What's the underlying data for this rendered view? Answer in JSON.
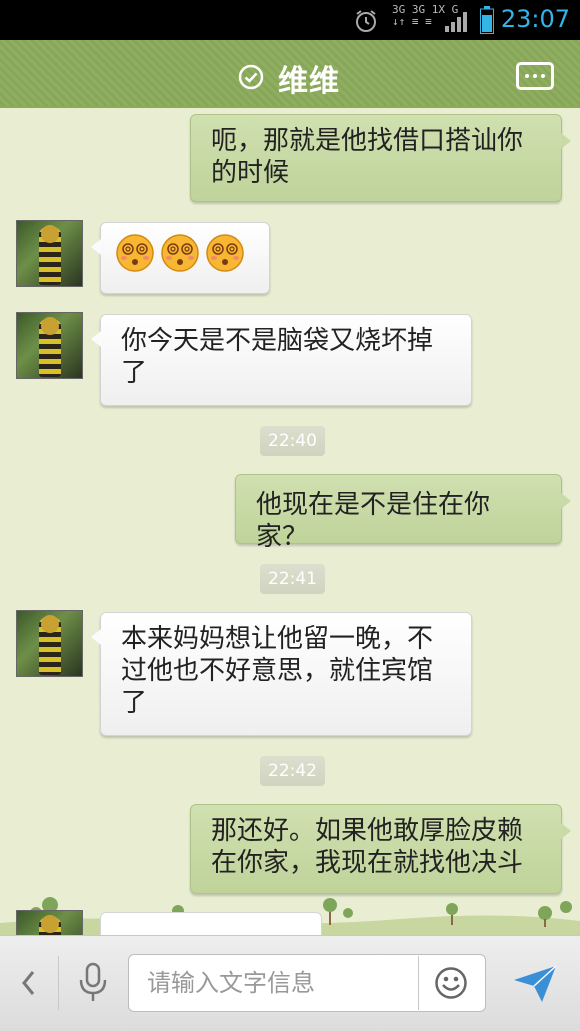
{
  "status_bar": {
    "time": "23:07",
    "network_line1": "3G 3G 1X G",
    "network_line2": "↓↑  ≡  ≡",
    "icons": [
      "alarm-icon",
      "signal-icon",
      "battery-icon"
    ]
  },
  "header": {
    "title": "维维",
    "icons": [
      "check-circle-icon",
      "menu-icon"
    ]
  },
  "messages": [
    {
      "side": "out",
      "text": "呃，那就是他找借口搭讪你的时候"
    },
    {
      "side": "in",
      "type": "emoji",
      "emoji_count": 3,
      "emoji": "dizzy-face-icon"
    },
    {
      "side": "in",
      "text": "你今天是不是脑袋又烧坏掉了"
    },
    {
      "type": "timestamp",
      "text": "22:40"
    },
    {
      "side": "out",
      "text": "他现在是不是住在你家？"
    },
    {
      "type": "timestamp",
      "text": "22:41"
    },
    {
      "side": "in",
      "text": "本来妈妈想让他留一晚，不过他也不好意思，就住宾馆了"
    },
    {
      "type": "timestamp",
      "text": "22:42"
    },
    {
      "side": "out",
      "text": "那还好。如果他敢厚脸皮赖在你家，我现在就找他决斗"
    }
  ],
  "input_bar": {
    "placeholder": "请输入文字信息",
    "icons": [
      "back-arrow-icon",
      "microphone-icon",
      "smiley-icon",
      "send-icon"
    ]
  },
  "colors": {
    "header_bg": "#8bab5b",
    "outgoing_bubble": "#c6d8a4",
    "incoming_bubble": "#fafafa",
    "clock": "#33b5e5",
    "send": "#3a8fd6"
  }
}
